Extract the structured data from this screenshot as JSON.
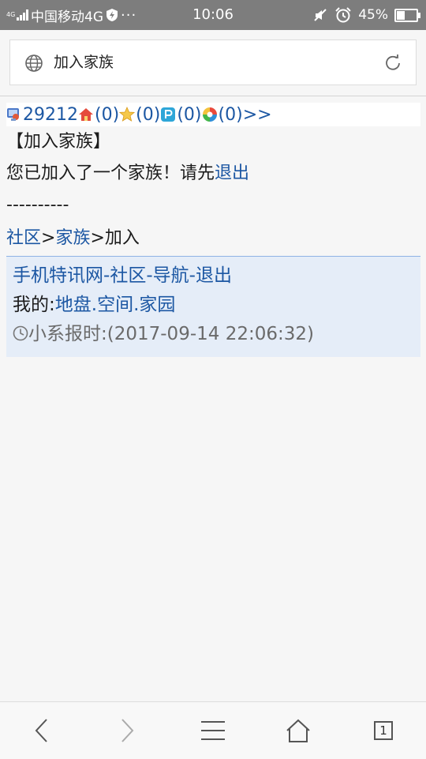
{
  "status_bar": {
    "network_tag": "4G",
    "carrier": "中国移动4G",
    "more": "···",
    "time": "10:06",
    "battery_percent": "45%",
    "battery_level": 0.45
  },
  "url_bar": {
    "title": "加入家族"
  },
  "nav": {
    "user_id": "29212",
    "counts": [
      "(0)",
      "(0)",
      "(0)",
      "(0)"
    ],
    "more": ">>"
  },
  "page": {
    "heading": "【加入家族】",
    "message_prefix": "您已加入了一个家族！请先",
    "message_link": "退出",
    "separator": "----------"
  },
  "breadcrumb": {
    "items": [
      "社区",
      "家族"
    ],
    "sep": ">",
    "current": "加入"
  },
  "footer": {
    "links_row": [
      "手机特讯网",
      "社区",
      "导航",
      "退出"
    ],
    "links_sep": "-",
    "mine_label": "我的:",
    "mine_links": [
      "地盘",
      "空间",
      "家园"
    ],
    "mine_sep": ".",
    "time_label": "小系报时:",
    "time_value": "(2017-09-14 22:06:32)"
  },
  "toolbar": {
    "tab_count": "1"
  },
  "colors": {
    "link": "#1c57a3",
    "status_bar_bg": "#7d7d7d",
    "footer_bg": "#e5edf8"
  }
}
